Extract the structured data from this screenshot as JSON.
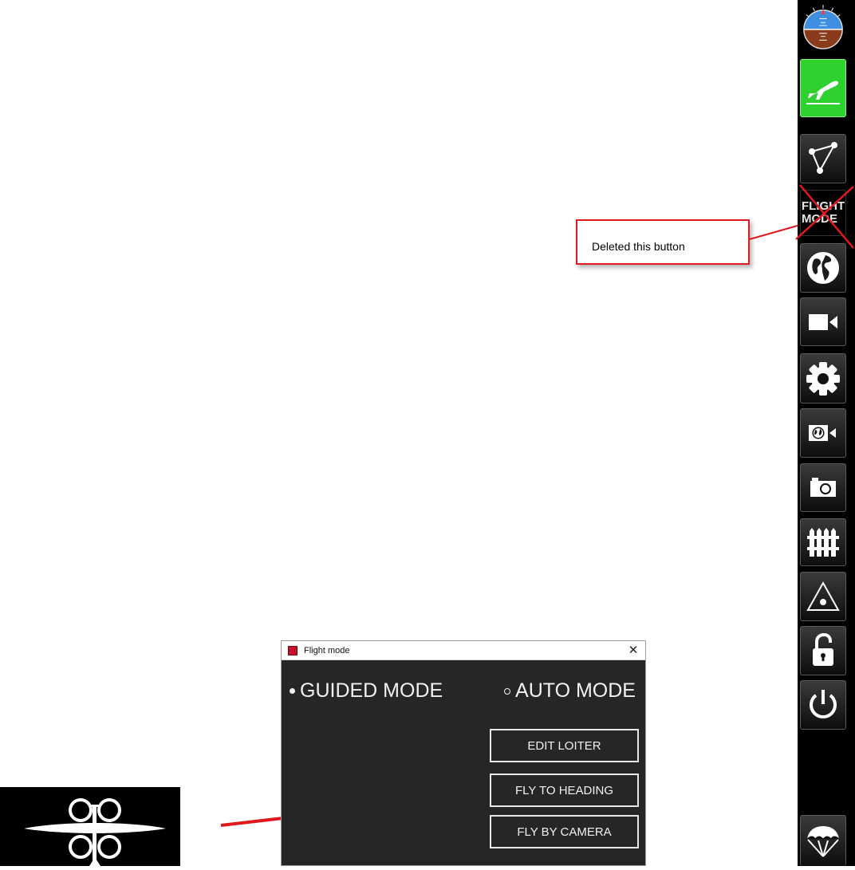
{
  "toolbar": {
    "items": [
      {
        "name": "attitude-indicator-button",
        "icon": "attitude-indicator-icon"
      },
      {
        "name": "takeoff-button",
        "icon": "takeoff-icon",
        "active": true
      },
      {
        "name": "waypoints-button",
        "icon": "waypoint-path-icon"
      },
      {
        "name": "flight-mode-button",
        "label_line1": "FLIGHT",
        "label_line2": "MODE",
        "deleted": true
      },
      {
        "name": "map-button",
        "icon": "globe-icon"
      },
      {
        "name": "video-button",
        "icon": "video-camera-icon"
      },
      {
        "name": "settings-button",
        "icon": "gear-icon"
      },
      {
        "name": "geo-video-button",
        "icon": "globe-camera-icon"
      },
      {
        "name": "photo-button",
        "icon": "camera-icon"
      },
      {
        "name": "geofence-button",
        "icon": "fence-icon"
      },
      {
        "name": "point-of-interest-button",
        "icon": "triangle-point-icon"
      },
      {
        "name": "lock-button",
        "icon": "unlock-icon"
      },
      {
        "name": "power-button",
        "icon": "power-icon"
      },
      {
        "name": "parachute-button",
        "icon": "parachute-icon"
      }
    ],
    "active_color": "#2fd12f"
  },
  "annotation": {
    "text": "Deleted this button",
    "color": "#e0191f"
  },
  "dialog": {
    "title": "Flight mode",
    "close": "✕",
    "modes": {
      "guided": "GUIDED MODE",
      "auto": "AUTO MODE",
      "selected": "GUIDED MODE"
    },
    "buttons": {
      "edit_loiter": "EDIT LOITER",
      "fly_to_heading": "FLY TO HEADING",
      "fly_by_camera": "FLY BY CAMERA"
    }
  },
  "drone_thumbnail": {
    "icon": "quadcopter-icon"
  },
  "arrow": {
    "color": "#e0191f"
  }
}
